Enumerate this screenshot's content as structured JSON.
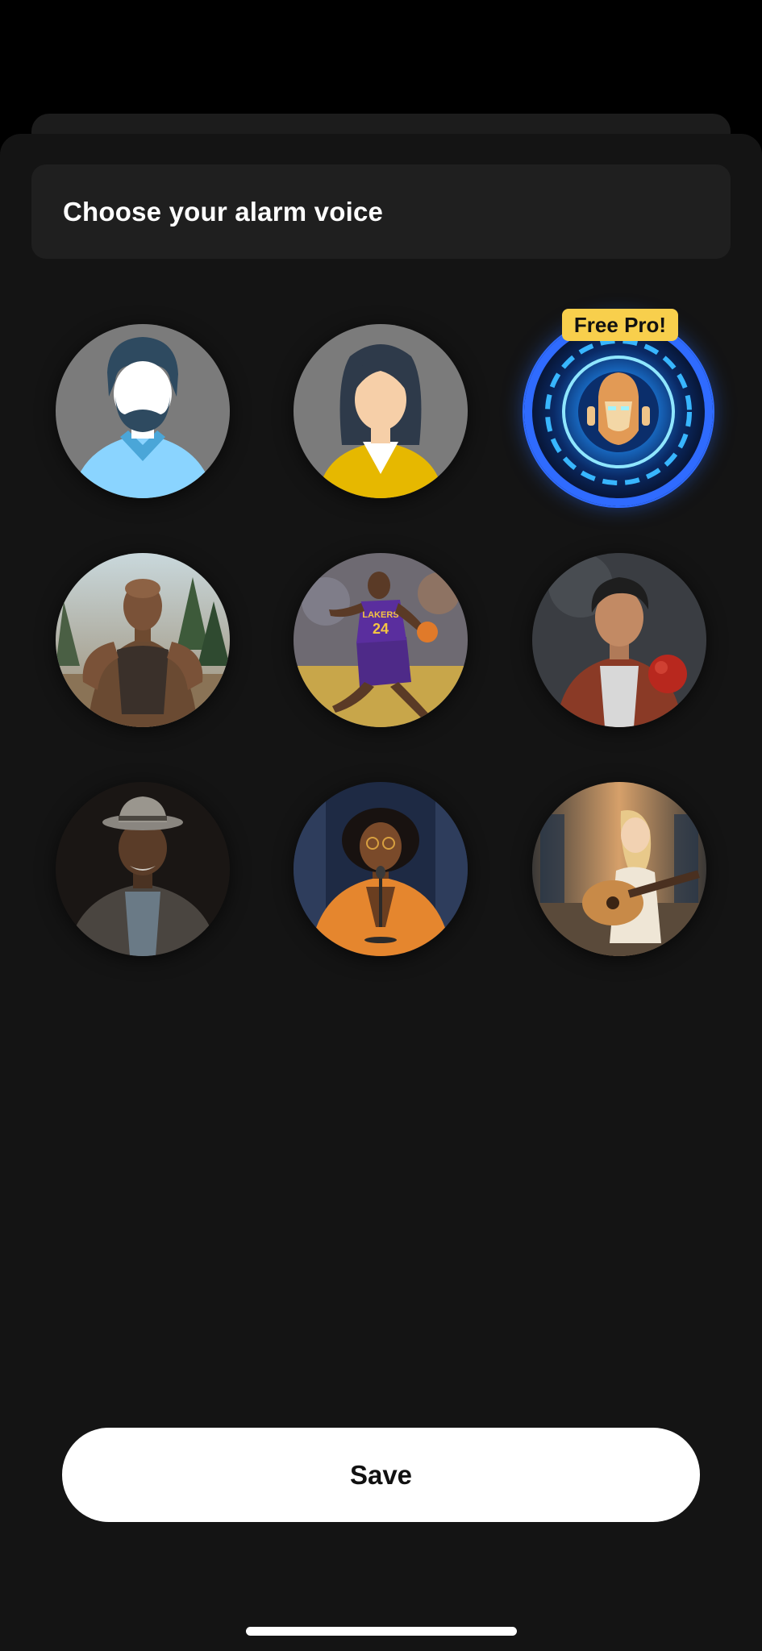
{
  "sheet": {
    "title": "Choose your alarm voice"
  },
  "voices": [
    {
      "id": "male-avatar",
      "icon": "male-avatar-icon",
      "selected": false
    },
    {
      "id": "female-avatar",
      "icon": "female-avatar-icon",
      "selected": false
    },
    {
      "id": "robot-voice",
      "icon": "robot-icon",
      "selected": true,
      "badge": "Free Pro!"
    },
    {
      "id": "athlete-runner",
      "icon": "portrait-photo",
      "selected": false
    },
    {
      "id": "basketball-player",
      "icon": "portrait-photo",
      "selected": false,
      "jersey_text": "LAKERS",
      "jersey_number": "24"
    },
    {
      "id": "boxer",
      "icon": "portrait-photo",
      "selected": false
    },
    {
      "id": "older-man-hat",
      "icon": "portrait-photo",
      "selected": false
    },
    {
      "id": "woman-microphone",
      "icon": "portrait-photo",
      "selected": false
    },
    {
      "id": "guitar-singer",
      "icon": "portrait-photo",
      "selected": false
    }
  ],
  "badge": {
    "label": "Free Pro!"
  },
  "actions": {
    "save_label": "Save"
  },
  "colors": {
    "background": "#141414",
    "card": "#1f1f1f",
    "accent_blue": "#2f6bff",
    "badge_yellow": "#f8cf4c",
    "button": "#ffffff"
  }
}
